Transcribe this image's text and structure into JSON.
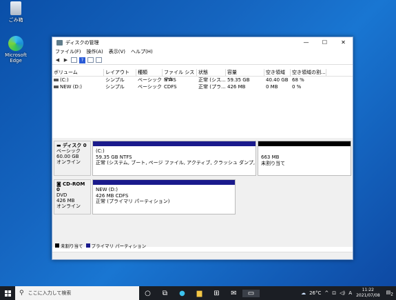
{
  "desktop": {
    "icons": [
      {
        "label": "ごみ箱"
      },
      {
        "label": "Microsoft Edge"
      }
    ]
  },
  "window": {
    "title": "ディスクの管理",
    "controls": {
      "minimize": "—",
      "maximize": "☐",
      "close": "✕"
    },
    "menu": [
      "ファイル(F)",
      "操作(A)",
      "表示(V)",
      "ヘルプ(H)"
    ],
    "volume_columns": [
      "ボリューム",
      "レイアウト",
      "種類",
      "ファイル システム",
      "状態",
      "容量",
      "空き領域",
      "空き領域の割..."
    ],
    "volumes": [
      [
        "(C:)",
        "シンプル",
        "ベーシック",
        "NTFS",
        "正常 (シス...",
        "59.35 GB",
        "40.40 GB",
        "68 %"
      ],
      [
        "NEW (D:)",
        "シンプル",
        "ベーシック",
        "CDFS",
        "正常 (プラ...",
        "426 MB",
        "0 MB",
        "0 %"
      ]
    ],
    "disks": [
      {
        "name": "ディスク 0",
        "lines": [
          "ベーシック",
          "60.00 GB",
          "オンライン"
        ],
        "partitions": [
          {
            "title": "(C:)",
            "line1": "59.35 GB NTFS",
            "line2": "正常 (システム, ブート, ページ ファイル, アクティブ, クラッシュ ダンプ, プライマリ パーティション)"
          },
          {
            "title": "",
            "line1": "663 MB",
            "line2": "未割り当て"
          }
        ]
      },
      {
        "name": "CD-ROM 0",
        "lines": [
          "DVD",
          "426 MB",
          "オンライン"
        ],
        "partitions": [
          {
            "title": "NEW  (D:)",
            "line1": "426 MB CDFS",
            "line2": "正常 (プライマリ パーティション)"
          }
        ]
      }
    ],
    "legend": [
      {
        "label": "未割り当て",
        "color": "#000000"
      },
      {
        "label": "プライマリ パーティション",
        "color": "#1a1a8c"
      }
    ]
  },
  "taskbar": {
    "search_placeholder": "ここに入力して検索",
    "weather": "26°C",
    "ime": "A",
    "time": "11:22",
    "date": "2021/07/08",
    "notification_count": "2"
  },
  "colors": {
    "primary_partition": "#1a1a8c",
    "unallocated": "#000000",
    "taskbar": "#1b1e24"
  }
}
